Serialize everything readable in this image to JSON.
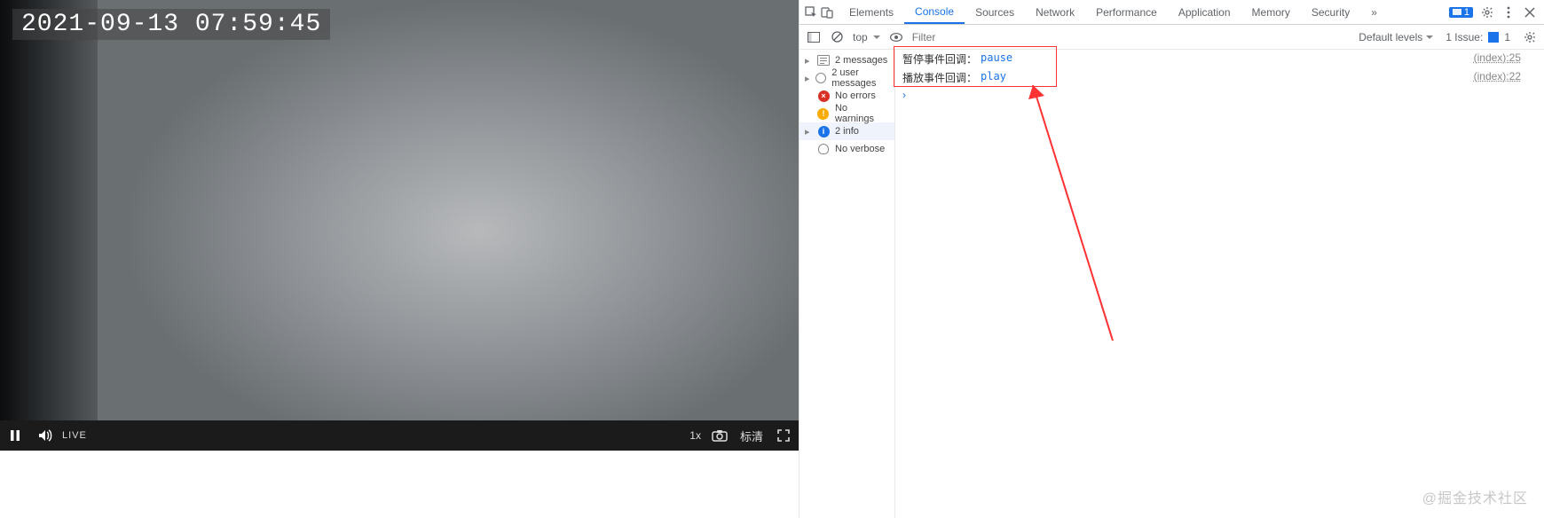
{
  "player": {
    "timestamp": "2021-09-13 07:59:45",
    "live_label": "LIVE",
    "rate_label": "1x",
    "quality_label": "标清"
  },
  "devtools": {
    "tabs": [
      "Elements",
      "Console",
      "Sources",
      "Network",
      "Performance",
      "Application",
      "Memory",
      "Security"
    ],
    "active_tab": "Console",
    "toolbar": {
      "scope_label": "top",
      "filter_placeholder": "Filter",
      "levels_label": "Default levels",
      "issues_label": "1 Issue:",
      "issues_badge": "1",
      "tab_badge": "1"
    },
    "sidebar": {
      "items": [
        {
          "label": "2 messages",
          "icon": "lines",
          "expandable": true
        },
        {
          "label": "2 user messages",
          "icon": "user",
          "expandable": true
        },
        {
          "label": "No errors",
          "icon": "error"
        },
        {
          "label": "No warnings",
          "icon": "warn"
        },
        {
          "label": "2 info",
          "icon": "info",
          "expandable": true,
          "selected": true
        },
        {
          "label": "No verbose",
          "icon": "bug"
        }
      ]
    },
    "logs": [
      {
        "text": "暂停事件回调：",
        "value": "pause",
        "source": "(index):25"
      },
      {
        "text": "播放事件回调：",
        "value": "play",
        "source": "(index):22"
      }
    ]
  },
  "watermark": "@掘金技术社区"
}
